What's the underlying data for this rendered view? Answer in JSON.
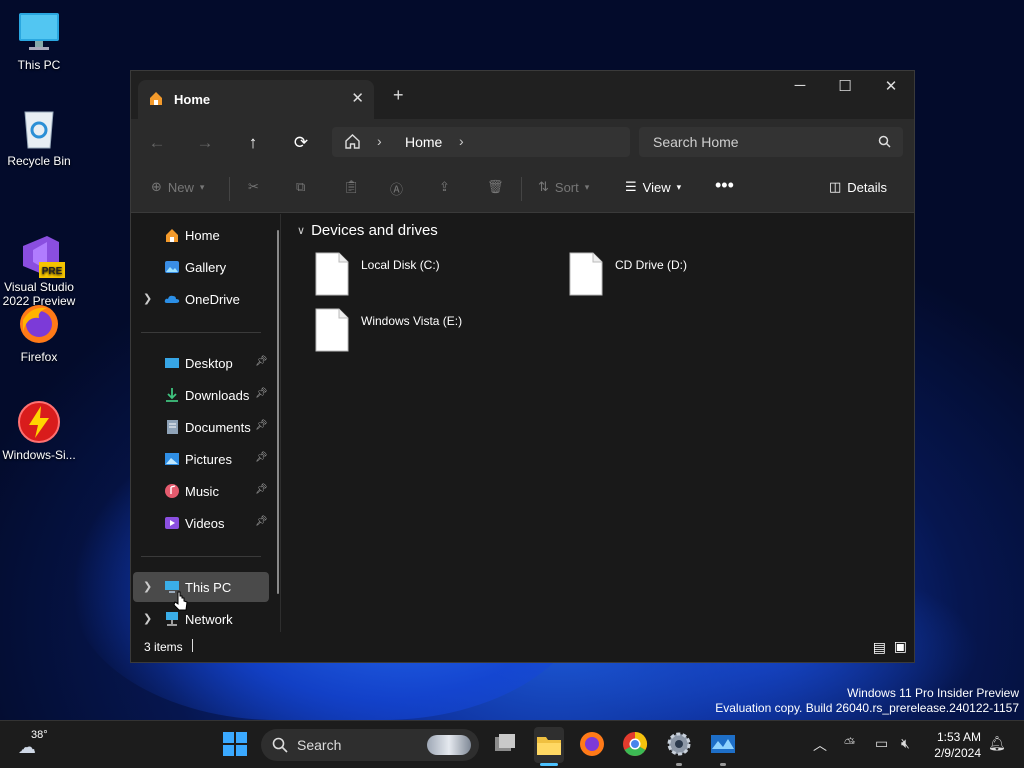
{
  "desktop": {
    "icons": [
      {
        "label": "This PC"
      },
      {
        "label": "Recycle Bin"
      },
      {
        "label": "Visual Studio\n2022 Preview",
        "badge": "PRE"
      },
      {
        "label": "Firefox"
      },
      {
        "label": "Windows-Si..."
      }
    ]
  },
  "window": {
    "tab_label": "Home",
    "address": {
      "crumb": "Home"
    },
    "search_placeholder": "Search Home",
    "commands": {
      "new": "New",
      "sort": "Sort",
      "view": "View",
      "details": "Details"
    },
    "sidebar": {
      "items": [
        {
          "label": "Home",
          "icon": "home-icon"
        },
        {
          "label": "Gallery",
          "icon": "gallery-icon"
        },
        {
          "label": "OneDrive",
          "icon": "cloud-icon"
        },
        {
          "label": "Desktop",
          "icon": "desktop-icon"
        },
        {
          "label": "Downloads",
          "icon": "download-icon"
        },
        {
          "label": "Documents",
          "icon": "documents-icon"
        },
        {
          "label": "Pictures",
          "icon": "pictures-icon"
        },
        {
          "label": "Music",
          "icon": "music-icon"
        },
        {
          "label": "Videos",
          "icon": "videos-icon"
        },
        {
          "label": "This PC",
          "icon": "pc-icon"
        },
        {
          "label": "Network",
          "icon": "network-icon"
        }
      ]
    },
    "main": {
      "group_title": "Devices and drives",
      "drives": [
        {
          "name": "Local Disk (C:)"
        },
        {
          "name": "CD Drive (D:)"
        },
        {
          "name": "Windows Vista (E:)"
        }
      ]
    },
    "status": {
      "count": "3 items"
    }
  },
  "watermark": {
    "line1": "Windows 11 Pro Insider Preview",
    "line2": "Evaluation copy. Build 26040.rs_prerelease.240122-1157"
  },
  "taskbar": {
    "weather_temp": "38°",
    "search_label": "Search",
    "time": "1:53 AM",
    "date": "2/9/2024"
  },
  "colors": {
    "accent": "#4cc2ff",
    "folder": "#f0c040",
    "taskbar": "#1c1c1c"
  }
}
